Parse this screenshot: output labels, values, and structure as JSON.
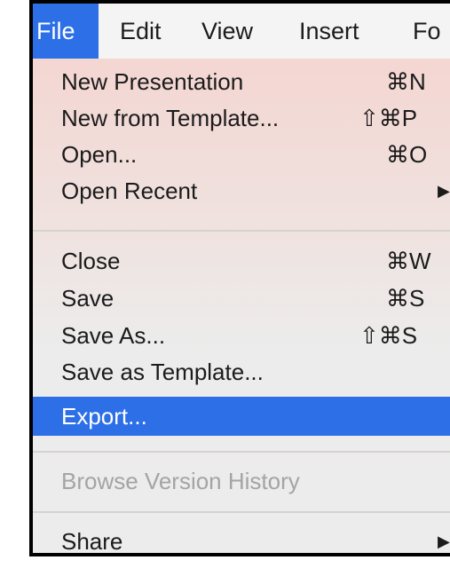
{
  "menu_bar": {
    "items": [
      {
        "label": "File",
        "active": true
      },
      {
        "label": "Edit",
        "active": false
      },
      {
        "label": "View",
        "active": false
      },
      {
        "label": "Insert",
        "active": false
      },
      {
        "label": "Fo",
        "active": false
      }
    ]
  },
  "file_menu": {
    "items": [
      {
        "label": "New Presentation",
        "shortcut": "⌘N"
      },
      {
        "label": "New from Template...",
        "shortcut": "⇧⌘P"
      },
      {
        "label": "Open...",
        "shortcut": "⌘O"
      },
      {
        "label": "Open Recent",
        "submenu_arrow": "▶"
      },
      {
        "label": "Close",
        "shortcut": "⌘W"
      },
      {
        "label": "Save",
        "shortcut": "⌘S"
      },
      {
        "label": "Save As...",
        "shortcut": "⇧⌘S"
      },
      {
        "label": "Save as Template..."
      },
      {
        "label": "Export...",
        "state": "highlighted"
      },
      {
        "label": "Browse Version History",
        "state": "disabled"
      },
      {
        "label": "Share",
        "submenu_arrow": "▶"
      }
    ]
  },
  "colors": {
    "accent": "#2d6fe6",
    "menu_text": "#1b1b1b",
    "disabled_text": "#a4a4a4",
    "highlight_text": "#ffffff"
  }
}
